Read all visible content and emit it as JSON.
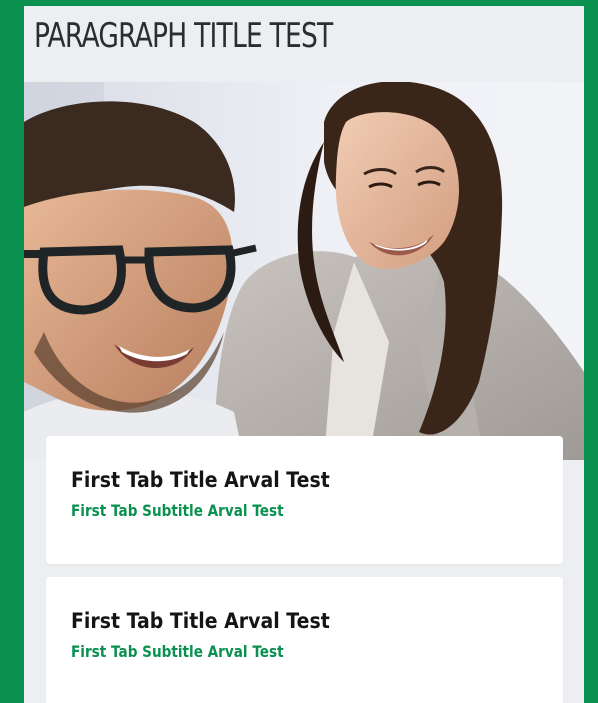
{
  "section": {
    "title": "PARAGRAPH TITLE TEST"
  },
  "cards": [
    {
      "title": "First Tab Title Arval Test",
      "subtitle": "First Tab Subtitle Arval Test"
    },
    {
      "title": "First Tab Title Arval Test",
      "subtitle": "First Tab Subtitle Arval Test"
    }
  ],
  "colors": {
    "page_background": "#0a9150",
    "panel_background": "#eceef1",
    "accent": "#0a9150",
    "title_text": "#2a2e33",
    "card_background": "#ffffff"
  }
}
